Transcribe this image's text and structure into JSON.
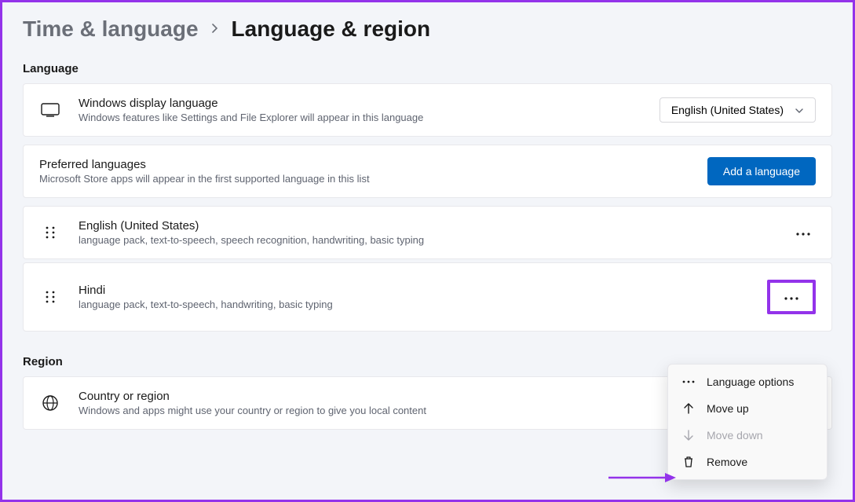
{
  "breadcrumb": {
    "parent": "Time & language",
    "current": "Language & region"
  },
  "sections": {
    "language_header": "Language",
    "region_header": "Region"
  },
  "display_language": {
    "title": "Windows display language",
    "subtitle": "Windows features like Settings and File Explorer will appear in this language",
    "selected": "English (United States)"
  },
  "preferred": {
    "title": "Preferred languages",
    "subtitle": "Microsoft Store apps will appear in the first supported language in this list",
    "add_button": "Add a language"
  },
  "languages": [
    {
      "name": "English (United States)",
      "features": "language pack, text-to-speech, speech recognition, handwriting, basic typing"
    },
    {
      "name": "Hindi",
      "features": "language pack, text-to-speech, handwriting, basic typing"
    }
  ],
  "country": {
    "title": "Country or region",
    "subtitle": "Windows and apps might use your country or region to give you local content"
  },
  "menu": {
    "options": "Language options",
    "move_up": "Move up",
    "move_down": "Move down",
    "remove": "Remove"
  }
}
